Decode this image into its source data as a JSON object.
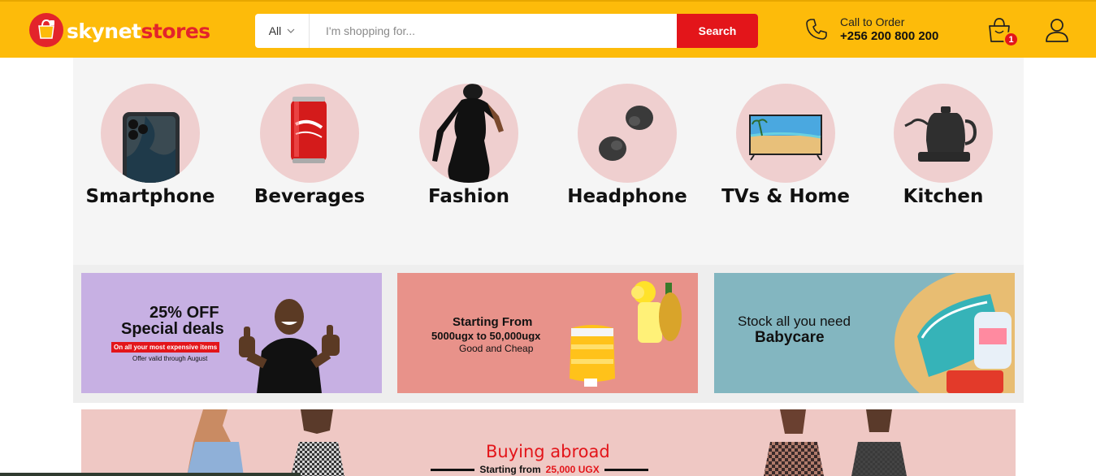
{
  "header": {
    "logo_part1": "skynet",
    "logo_part2": "stores",
    "search_category": "All",
    "search_placeholder": "I'm shopping for...",
    "search_button": "Search",
    "call_label": "Call to Order",
    "call_number": "+256 200 800 200",
    "cart_count": "1"
  },
  "categories": [
    {
      "label": "Smartphone",
      "icon": "smartphone-icon"
    },
    {
      "label": "Beverages",
      "icon": "soda-can-icon"
    },
    {
      "label": "Fashion",
      "icon": "fashion-model-icon"
    },
    {
      "label": "Headphone",
      "icon": "earbuds-icon"
    },
    {
      "label": "TVs & Home",
      "icon": "tv-icon"
    },
    {
      "label": "Kitchen",
      "icon": "kettle-icon"
    }
  ],
  "banners": {
    "deals": {
      "line1": "25% OFF",
      "line2": "Special deals",
      "line3": "On all your most expensive items",
      "line4": "Offer valid through August"
    },
    "starting": {
      "line1": "Starting From",
      "line2": "5000ugx to 50,000ugx",
      "line3": "Good and Cheap"
    },
    "babycare": {
      "line1": "Stock all you need",
      "line2": "Babycare"
    },
    "abroad": {
      "title": "Buying abroad",
      "sub_prefix": "Starting from",
      "sub_price": "25,000 UGX"
    }
  },
  "colors": {
    "header_bg": "#fdbb0a",
    "accent_red": "#e3151a",
    "category_circle": "#efcfcf"
  }
}
